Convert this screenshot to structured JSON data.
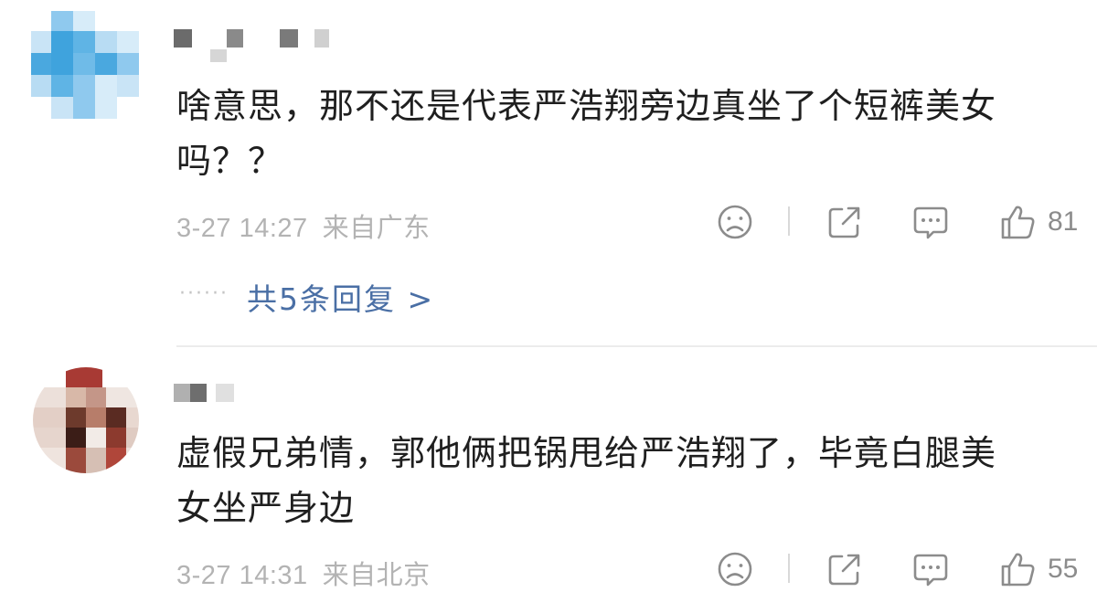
{
  "comments": [
    {
      "text_line1": "啥意思，那不还是代表严浩翔旁边真坐了个短裤美女",
      "text_line2": "吗？？",
      "date": "3-27 14:27",
      "source": "来自广东",
      "likes": "81",
      "replies_label": "共5条回复 >",
      "replies_dots": "······",
      "avatar_colors": [
        "#3fa3dd",
        "#8fc9ee",
        "#c9e4f6",
        "#5fb4e5"
      ]
    },
    {
      "text_line1": "虚假兄弟情，郭他俩把锅甩给严浩翔了，毕竟白腿美",
      "text_line2": "女坐严身边",
      "date": "3-27 14:31",
      "source": "来自北京",
      "likes": "55",
      "avatar_colors": [
        "#a83a34",
        "#5a2b22",
        "#d8b8a8",
        "#e8d8d0"
      ]
    }
  ],
  "icons": [
    "dislike-icon",
    "share-icon",
    "comment-icon",
    "like-icon"
  ]
}
